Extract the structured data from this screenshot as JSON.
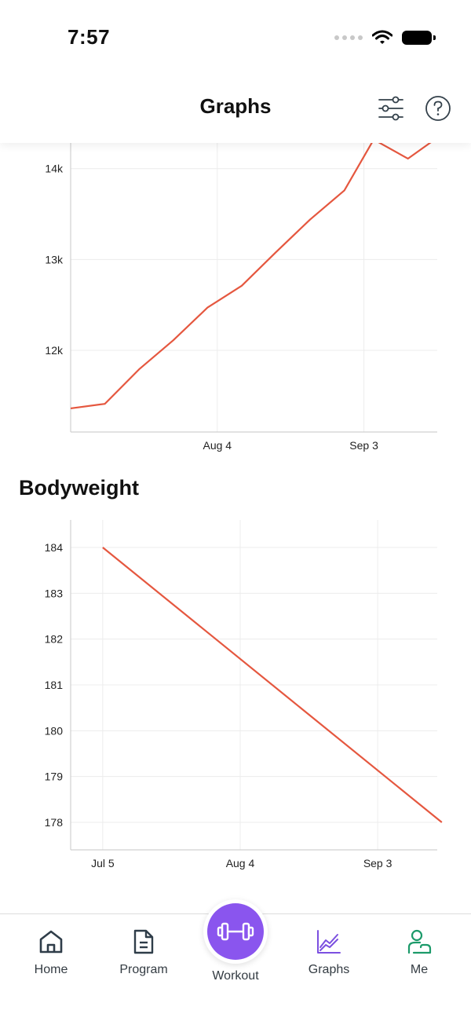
{
  "status_bar": {
    "time": "7:57"
  },
  "header": {
    "title": "Graphs",
    "filter_icon": "sliders-icon",
    "help_icon": "help-circle-icon"
  },
  "colors": {
    "line": "#e5573f",
    "accent": "#8a55ee",
    "active_tab": "#7b4fe0",
    "grid": "#ececec"
  },
  "chart_data": [
    {
      "type": "line",
      "title": "",
      "x_ticks": [
        "Aug 4",
        "Sep 3"
      ],
      "y_ticks": [
        "12k",
        "13k",
        "14k"
      ],
      "x": [
        "Jul 5",
        "Jul 12",
        "Jul 19",
        "Jul 26",
        "Aug 2",
        "Aug 9",
        "Aug 16",
        "Aug 23",
        "Aug 30",
        "Sep 5",
        "Sep 12",
        "Sep 18"
      ],
      "y": [
        11360,
        11410,
        11790,
        12110,
        12470,
        12710,
        13080,
        13440,
        13760,
        14320,
        14110,
        14340
      ],
      "ylim": [
        11100,
        14300
      ]
    },
    {
      "type": "line",
      "title": "Bodyweight",
      "x_ticks": [
        "Jul 5",
        "Aug 4",
        "Sep 3"
      ],
      "y_ticks": [
        "178",
        "179",
        "180",
        "181",
        "182",
        "183",
        "184"
      ],
      "x": [
        "Jul 5",
        "Sep 17"
      ],
      "y": [
        184,
        178
      ],
      "ylim": [
        177.4,
        184.6
      ]
    }
  ],
  "tabs": [
    {
      "label": "Home",
      "icon": "home-icon"
    },
    {
      "label": "Program",
      "icon": "document-icon"
    },
    {
      "label": "Workout",
      "icon": "dumbbell-icon"
    },
    {
      "label": "Graphs",
      "icon": "chart-icon"
    },
    {
      "label": "Me",
      "icon": "profile-icon"
    }
  ]
}
